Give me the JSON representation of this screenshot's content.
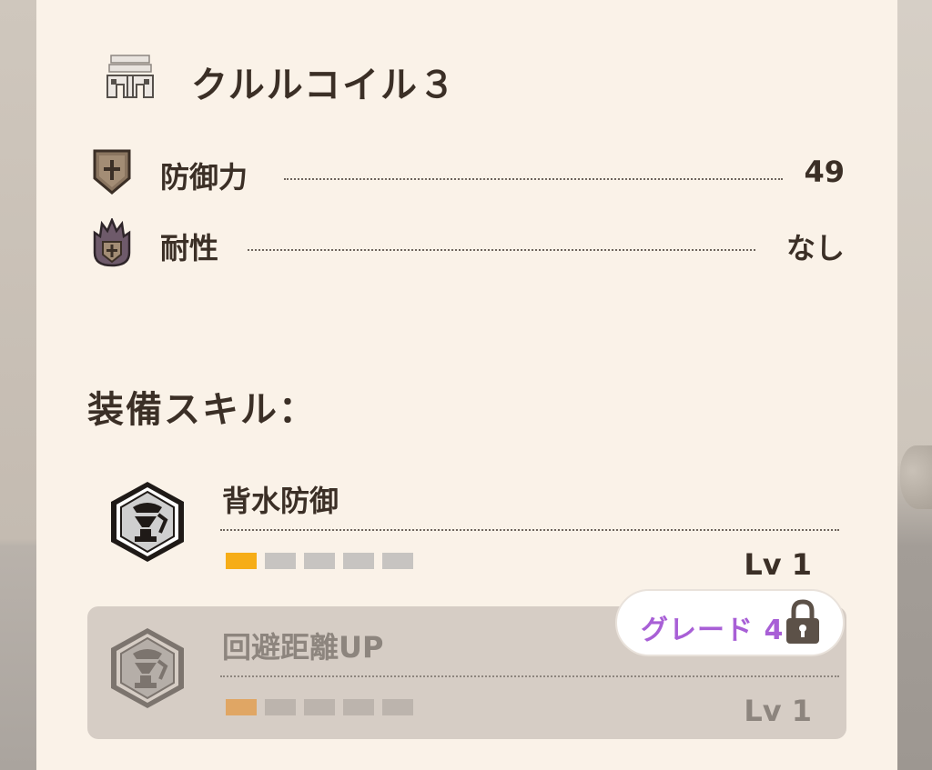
{
  "item": {
    "name": "クルルコイル３",
    "icon": "armor-coil-icon"
  },
  "stats": [
    {
      "label": "防御力",
      "value": "49",
      "icon": "defense-shield-icon"
    },
    {
      "label": "耐性",
      "value": "なし",
      "icon": "resistance-flame-icon"
    }
  ],
  "skills_section": {
    "title": "装備スキル："
  },
  "skills": [
    {
      "name": "背水防御",
      "level": "Lv 1",
      "level_filled": 1,
      "level_max": 5,
      "locked": false,
      "icon": "skill-hexagon-icon"
    },
    {
      "name": "回避距離UP",
      "level": "Lv 1",
      "level_filled": 1,
      "level_max": 5,
      "locked": true,
      "icon": "skill-hexagon-icon"
    }
  ],
  "grade_badge": {
    "label": "グレード 4",
    "icon": "lock-icon"
  },
  "colors": {
    "panel_bg": "#faf2e8",
    "text": "#3b2f26",
    "level_active": "#f6ad17",
    "grade_text": "#a85fd6",
    "locked_bg": "#d6cdc5"
  }
}
